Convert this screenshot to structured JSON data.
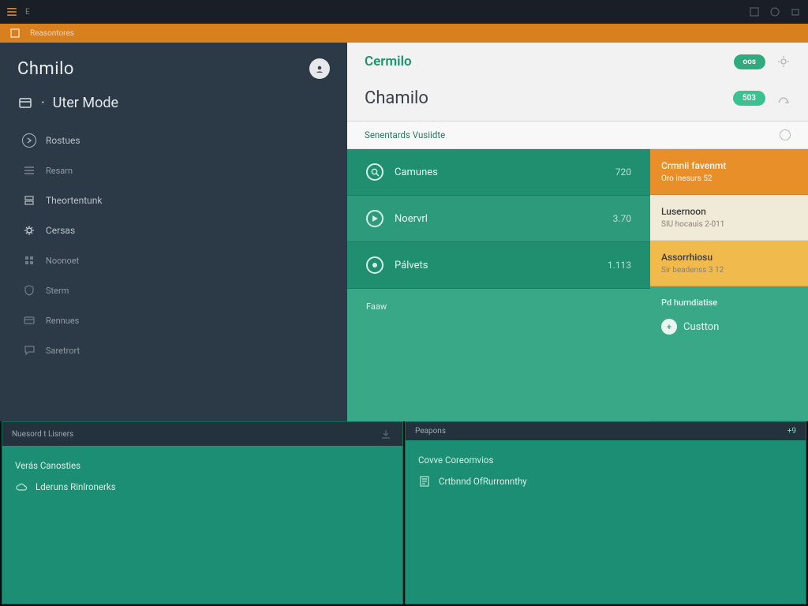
{
  "osbar": {
    "label": "E"
  },
  "tabstrip": {
    "label": "Reasontores"
  },
  "sidebar": {
    "brand": "Chmilo",
    "mode_prefix": "·",
    "mode": "Uter Mode",
    "items": [
      {
        "label": "Rostues"
      },
      {
        "label": "Resarn"
      },
      {
        "label": "Theortentunk"
      },
      {
        "label": "Cersas"
      },
      {
        "label": "Noonoet"
      },
      {
        "label": "Sterm"
      },
      {
        "label": "Rennues"
      },
      {
        "label": "Saretrort"
      }
    ]
  },
  "main": {
    "title1": "Cermilo",
    "title2": "Chamilo",
    "pill1": "oos",
    "pill2": "503",
    "sub": "Senentards Vusiidte",
    "list": [
      {
        "label": "Camunes",
        "value": "720"
      },
      {
        "label": "Noervrl",
        "value": "3.70"
      },
      {
        "label": "Pálvets",
        "value": "1.113"
      }
    ],
    "list_foot": "Faaw",
    "side": [
      {
        "title": "Crmnii favenmt",
        "detail": "Oro inesurs 52"
      },
      {
        "title": "Lusernoon",
        "detail": "SIU hocauis 2-011"
      },
      {
        "title": "Assorrhiosu",
        "detail": "Sir beadenss 3 12"
      },
      {
        "title_prefix": "Pd hurndiatise",
        "button": "Custton"
      }
    ]
  },
  "panels": {
    "left": {
      "head": "Nuesord t Lisners",
      "r1": "Verás Canosties",
      "r2": "Lderuns Rinlronerks"
    },
    "right": {
      "head": "Peapons",
      "badge": "+9",
      "r1": "Covve Coreomvios",
      "r2": "Crtbnnd OfRurronnthy"
    }
  }
}
